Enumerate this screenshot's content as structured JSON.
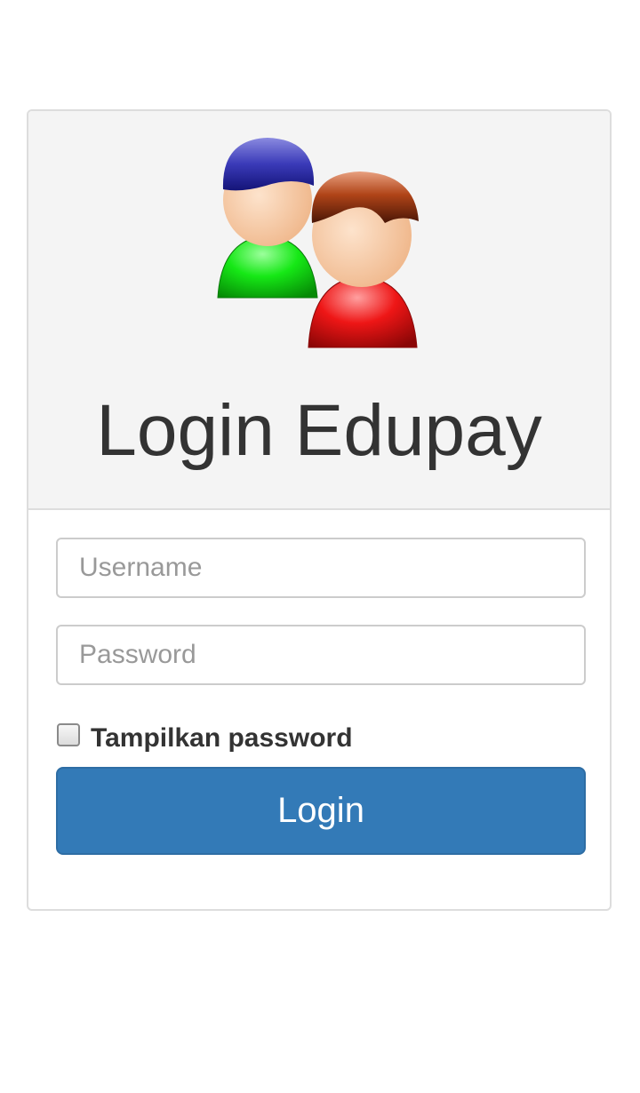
{
  "header": {
    "icon": "users-icon",
    "title": "Login Edupay"
  },
  "form": {
    "username_placeholder": "Username",
    "username_value": "",
    "password_placeholder": "Password",
    "password_value": "",
    "show_password_label": "Tampilkan password",
    "show_password_checked": false,
    "login_label": "Login"
  },
  "colors": {
    "primary_button": "#337ab7",
    "heading_background": "#f4f4f4",
    "title_text": "#333333"
  }
}
